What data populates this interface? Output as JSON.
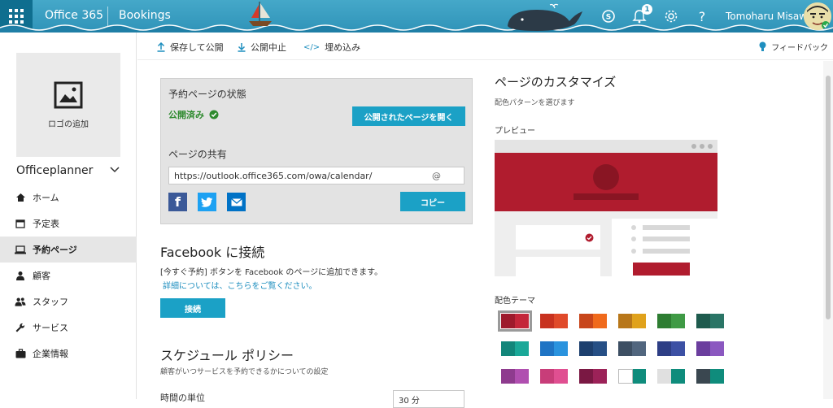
{
  "topbar": {
    "brand": "Office 365",
    "app": "Bookings",
    "notification_count": "1",
    "user_name": "Tomoharu Misawa"
  },
  "sidebar": {
    "logo_label": "ロゴの追加",
    "business_name": "Officeplanner",
    "items": [
      {
        "label": "ホーム",
        "icon": "home-icon"
      },
      {
        "label": "予定表",
        "icon": "calendar-icon"
      },
      {
        "label": "予約ページ",
        "icon": "laptop-icon",
        "active": true
      },
      {
        "label": "顧客",
        "icon": "person-icon"
      },
      {
        "label": "スタッフ",
        "icon": "people-icon"
      },
      {
        "label": "サービス",
        "icon": "wrench-icon"
      },
      {
        "label": "企業情報",
        "icon": "briefcase-icon"
      }
    ]
  },
  "toolbar": {
    "save_publish": "保存して公開",
    "unpublish": "公開中止",
    "embed": "埋め込み",
    "feedback": "フィードバック"
  },
  "status": {
    "title": "予約ページの状態",
    "state": "公開済み",
    "open_button": "公開されたページを開く",
    "share_title": "ページの共有",
    "url": "https://outlook.office365.com/owa/calendar/",
    "url_suffix": "@",
    "copy_button": "コピー"
  },
  "facebook": {
    "title": "Facebook に接続",
    "desc": "[今すぐ予約] ボタンを Facebook のページに追加できます。",
    "link": "詳細については、こちらをご覧ください。",
    "connect_button": "接続"
  },
  "schedule": {
    "title": "スケジュール ポリシー",
    "desc": "顧客がいつサービスを予約できるかについての設定",
    "time_unit_label": "時間の単位",
    "time_unit_value": "30 分"
  },
  "customize": {
    "title": "ページのカスタマイズ",
    "subtitle": "配色パターンを選びます",
    "preview_label": "プレビュー",
    "theme_label": "配色テーマ",
    "preview_accent": "#b01c2e",
    "swatches": [
      [
        "#9e1a2c",
        "#c4263a"
      ],
      [
        "#c8321f",
        "#e04a2a"
      ],
      [
        "#c8461b",
        "#f06a1c"
      ],
      [
        "#b8771a",
        "#e0a21c"
      ],
      [
        "#2e7d32",
        "#3f9a45"
      ],
      [
        "#1e5b4e",
        "#2a7566"
      ],
      [
        "#12867a",
        "#1aa898"
      ],
      [
        "#1f74c4",
        "#2a93de"
      ],
      [
        "#1d3f6e",
        "#264f85"
      ],
      [
        "#3d4f63",
        "#51667e"
      ],
      [
        "#2d3e85",
        "#3c50a4"
      ],
      [
        "#6b3e9e",
        "#8b58c0"
      ],
      [
        "#8e3b8e",
        "#b04fb0"
      ],
      [
        "#c83d79",
        "#e04f91"
      ],
      [
        "#7a1843",
        "#9c2258"
      ],
      [
        "#ffffff",
        "#0f8c7c"
      ],
      [
        "#e0e0e0",
        "#0f8c7c"
      ],
      [
        "#3a4750",
        "#0f8c7c"
      ]
    ]
  }
}
